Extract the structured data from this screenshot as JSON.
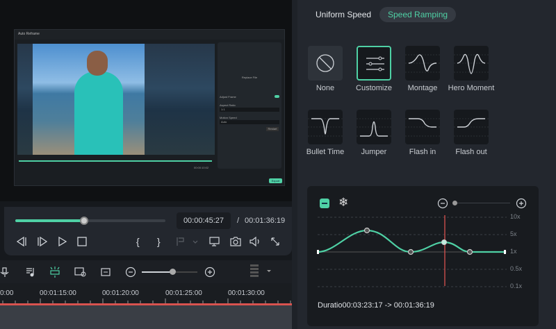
{
  "preview": {
    "dialog_title": "Auto Reframe",
    "replace_file": "Replace File",
    "adjust_frame": "Adjust Frame",
    "aspect_ratio": "Aspect Ratio",
    "aspect_value": "1:1",
    "motion_speed": "Motion Speed",
    "motion_value": "Auto",
    "restart": "Restart",
    "export": "Export",
    "video_time": "00:00:10:02"
  },
  "player": {
    "progress_percent": 46,
    "current_time": "00:00:45:27",
    "separator": "/",
    "total_time": "00:01:36:19",
    "mark_in": "{",
    "mark_out": "}"
  },
  "timeline": {
    "zoom_percent": 55,
    "ruler": [
      "0:00",
      "00:01:15:00",
      "00:01:20:00",
      "00:01:25:00",
      "00:01:30:00"
    ]
  },
  "speed": {
    "tabs": [
      {
        "label": "Uniform Speed",
        "active": false
      },
      {
        "label": "Speed Ramping",
        "active": true
      }
    ],
    "presets": [
      {
        "label": "None"
      },
      {
        "label": "Customize",
        "selected": true
      },
      {
        "label": "Montage"
      },
      {
        "label": "Hero Moment"
      },
      {
        "label": "Bullet Time"
      },
      {
        "label": "Jumper"
      },
      {
        "label": "Flash in"
      },
      {
        "label": "Flash out"
      }
    ],
    "graph": {
      "y_labels": [
        "10x",
        "5x",
        "1x",
        "0.5x",
        "0.1x"
      ],
      "zoom_percent": 0,
      "duration_label": "Duratio",
      "duration_value": "00:03:23:17 -> 00:01:36:19"
    }
  },
  "colors": {
    "accent": "#4fd1a5",
    "playhead": "#d9534f"
  }
}
